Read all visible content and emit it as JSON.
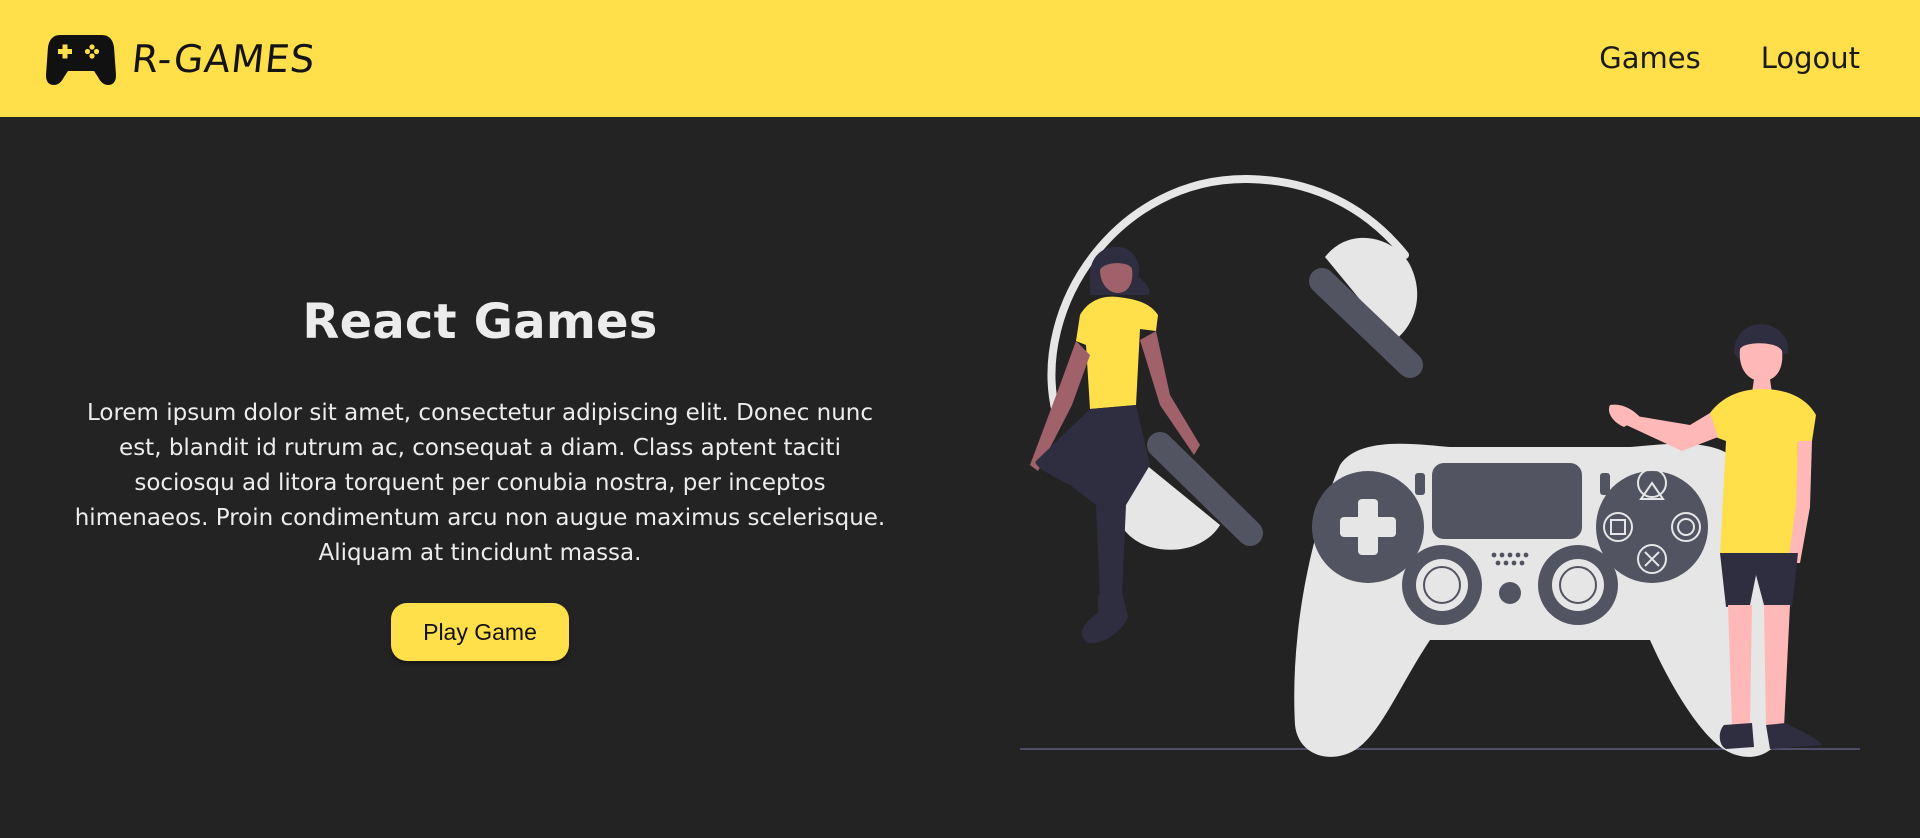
{
  "brand": {
    "name": "R-GAMES",
    "icon": "gamepad-icon"
  },
  "nav": {
    "items": [
      {
        "label": "Games"
      },
      {
        "label": "Logout"
      }
    ]
  },
  "hero": {
    "title": "React Games",
    "description": "Lorem ipsum dolor sit amet, consectetur adipiscing elit. Donec nunc est, blandit id rutrum ac, consequat a diam. Class aptent taciti sociosqu ad litora torquent per conubia nostra, per inceptos himenaeos. Proin condimentum arcu non augue maximus scelerisque. Aliquam at tincidunt massa.",
    "button_label": "Play Game"
  },
  "colors": {
    "accent": "#ffdf4a",
    "background": "#232323",
    "text": "#ececec"
  }
}
